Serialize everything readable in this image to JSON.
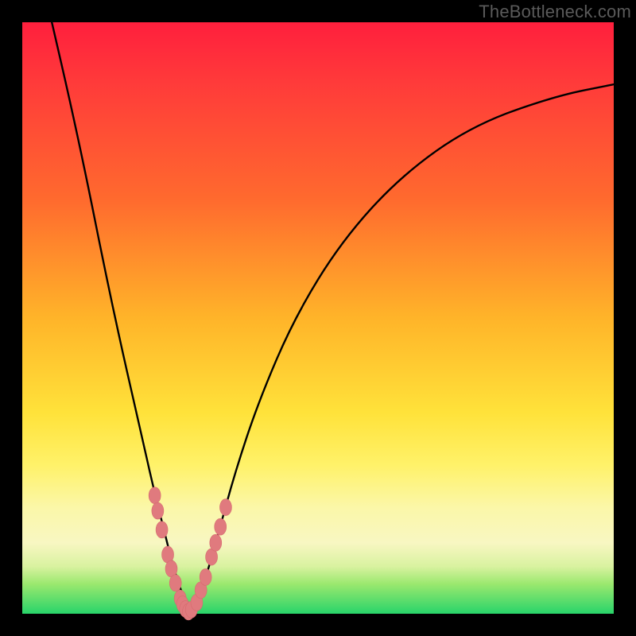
{
  "watermark": "TheBottleneck.com",
  "colors": {
    "curve_stroke": "#000000",
    "marker_fill": "#e07a7e",
    "marker_stroke": "#d66b6f"
  },
  "chart_data": {
    "type": "line",
    "title": "",
    "xlabel": "",
    "ylabel": "",
    "xlim": [
      0,
      100
    ],
    "ylim": [
      0,
      100
    ],
    "series": [
      {
        "name": "bottleneck-curve",
        "x": [
          5,
          8,
          11,
          14,
          17,
          20,
          22,
          24,
          25.5,
          27,
          27.8,
          28.5,
          29.3,
          31,
          33,
          36,
          40,
          46,
          54,
          64,
          76,
          90,
          100
        ],
        "y": [
          100,
          87,
          73,
          58,
          44,
          31,
          22,
          14,
          8,
          3.5,
          1.2,
          0.3,
          1.3,
          6,
          13,
          24,
          36,
          50,
          63,
          74,
          82.5,
          87.5,
          89.5
        ]
      }
    ],
    "markers": {
      "left_cluster": {
        "x": [
          22.4,
          22.9,
          23.6,
          24.6,
          25.2,
          25.9,
          26.7,
          27.1,
          27.6,
          28.1,
          28.6
        ],
        "y": [
          20.0,
          17.4,
          14.2,
          10.0,
          7.6,
          5.2,
          2.6,
          1.6,
          0.8,
          0.35,
          0.7
        ]
      },
      "right_cluster": {
        "x": [
          29.5,
          30.2,
          31.0,
          32.0,
          32.7,
          33.5,
          34.4
        ],
        "y": [
          1.9,
          4.0,
          6.2,
          9.6,
          12.0,
          14.7,
          18.0
        ]
      }
    }
  }
}
